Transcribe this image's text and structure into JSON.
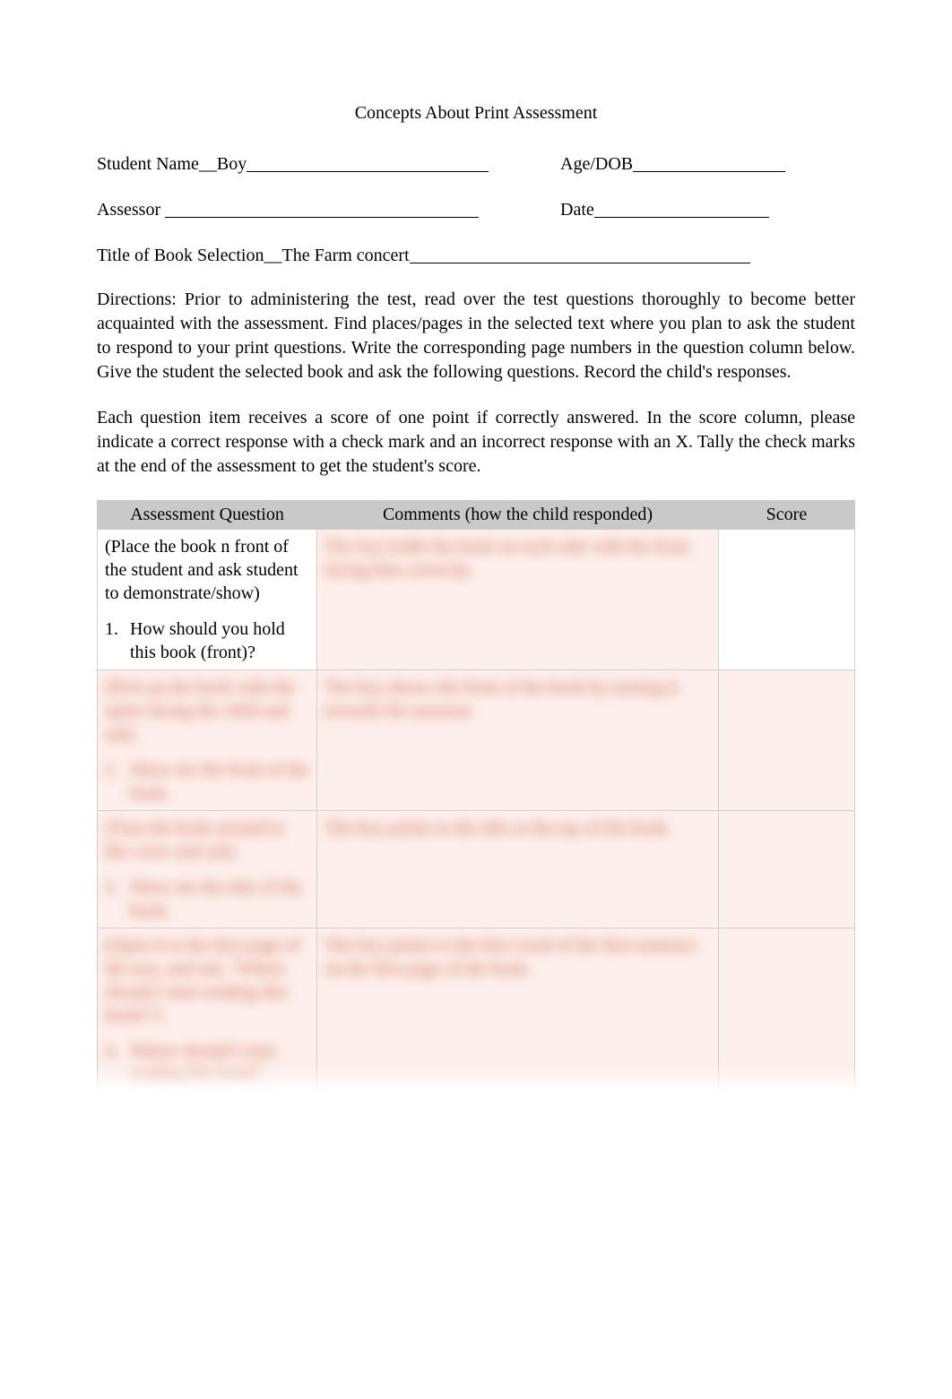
{
  "title": "Concepts About Print Assessment",
  "fields": {
    "student_name_label": "Student Name__",
    "student_name_value": "Boy",
    "age_label": "Age/DOB",
    "assessor_label": "Assessor",
    "date_label": "Date",
    "book_title_label": "Title of Book Selection__",
    "book_title_value": "The Farm concert"
  },
  "directions": "Directions: Prior to administering the test, read over the test questions thoroughly to become better acquainted with the assessment.     Find places/pages in the selected text where you plan to ask the student to respond to your print questions.     Write the corresponding page numbers in the question column below.   Give the student the selected book and ask the following questions. Record the child's responses.",
  "scoring": "Each question item receives a score of one point if correctly answered. In the score column, please indicate a correct response with a check mark and an incorrect response with an X. Tally the check marks at the end of the assessment to get the student's score.",
  "table": {
    "headers": {
      "question": "Assessment Question",
      "comments": "Comments (how the child responded)",
      "score": "Score"
    },
    "rows": [
      {
        "intro": "(Place the book n front of the student and ask student to demonstrate/show)",
        "num": "1.",
        "question": "How should you hold this book (front)?",
        "comment": "The boy holds the book on each side with the front facing him correctly.",
        "score": "",
        "blurred": false,
        "blur_comment_only": true
      },
      {
        "intro": "(Pick up the book with the spine facing the child and ask)",
        "num": "2.",
        "question": "Show me the front of the book.",
        "comment": "The boy shows the front of the book by turning it towards the assessor.",
        "score": "",
        "blurred": true
      },
      {
        "intro": "(Turn the book around to the cover and ask)",
        "num": "3.",
        "question": "Show me the title of the book.",
        "comment": "The boy points to the title at the top of the book.",
        "score": "",
        "blurred": true
      },
      {
        "intro": "(Open it to the first page of the text, and ask, \"Where should I start reading this book?\")",
        "num": "4.",
        "question": "Where should I start reading this book?",
        "comment": "The boy points to the first word of the first sentence on the first page of the book.",
        "score": "",
        "blurred": true
      }
    ]
  }
}
